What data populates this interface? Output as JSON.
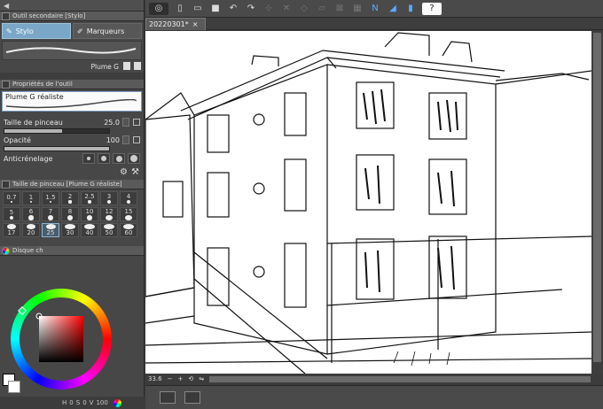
{
  "subtool_panel": {
    "title": "Outil secondaire [Stylo]",
    "tabs": [
      {
        "label": "Stylo",
        "active": true
      },
      {
        "label": "Marqueurs",
        "active": false
      }
    ],
    "current_brush": "Plume G"
  },
  "tool_properties": {
    "title": "Propriétés de l'outil",
    "tool_name": "Plume G réaliste",
    "brush_size_label": "Taille de pinceau",
    "brush_size_value": "25.0",
    "opacity_label": "Opacité",
    "opacity_value": "100",
    "antialiasing_label": "Anticrénelage"
  },
  "brush_size_panel": {
    "title": "Taille de pinceau [Plume G réaliste]",
    "sizes": [
      "0.7",
      "1",
      "1.5",
      "2",
      "2.5",
      "3",
      "4",
      "5",
      "6",
      "7",
      "8",
      "10",
      "12",
      "15",
      "17",
      "20",
      "25",
      "30",
      "40",
      "50",
      "60"
    ],
    "selected": "25"
  },
  "color_panel": {
    "title": "Disque ch",
    "h_label": "H",
    "h_value": "0",
    "s_label": "S",
    "s_value": "0",
    "v_label": "V",
    "v_value": "100"
  },
  "document": {
    "tab_name": "20220301*"
  },
  "canvas_status": {
    "zoom": "33.6"
  },
  "colors": {
    "accent_blue": "#7aa7c7",
    "panel_bg": "#474747",
    "canvas_bg": "#ffffff"
  }
}
